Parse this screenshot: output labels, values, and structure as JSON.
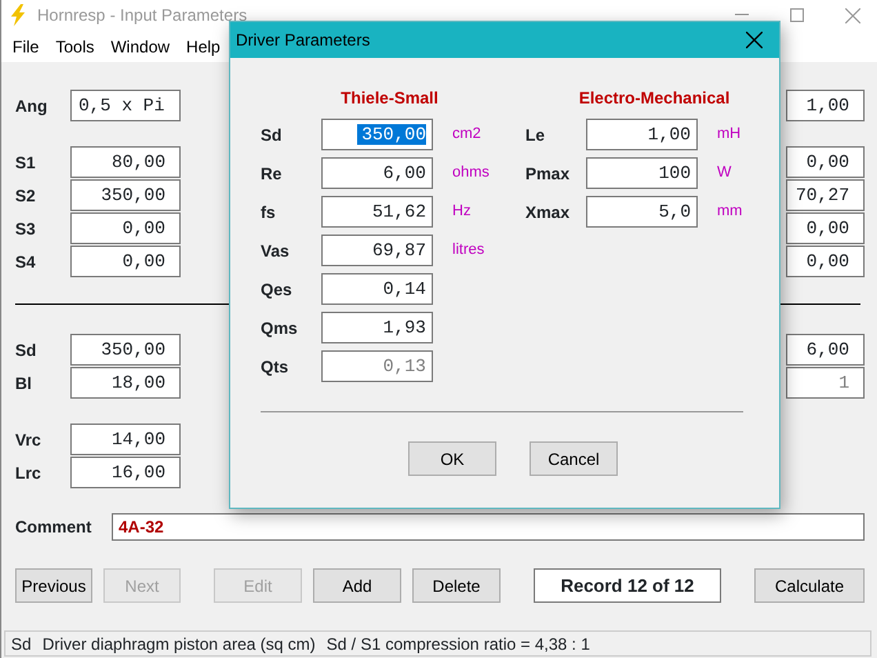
{
  "window": {
    "title": "Hornresp - Input Parameters"
  },
  "menu": [
    "File",
    "Tools",
    "Window",
    "Help"
  ],
  "upper": {
    "left": [
      [
        {
          "kind": "text",
          "label": "Ang",
          "value": "0,5 x Pi"
        }
      ],
      [
        {
          "kind": "number",
          "label": "S1",
          "value": "80,00"
        },
        {
          "kind": "number",
          "label": "S2",
          "value": "350,00"
        },
        {
          "kind": "number",
          "label": "S3",
          "value": "0,00"
        },
        {
          "kind": "number",
          "label": "S4",
          "value": "0,00"
        }
      ]
    ],
    "right": [
      [
        {
          "value": "1,00",
          "disabled": false
        }
      ],
      [
        {
          "value": "0,00",
          "disabled": false
        },
        {
          "value": "70,27",
          "disabled": false
        },
        {
          "value": "0,00",
          "disabled": false
        },
        {
          "value": "0,00",
          "disabled": false
        }
      ]
    ]
  },
  "lower": {
    "left": [
      [
        {
          "kind": "number",
          "label": "Sd",
          "value": "350,00"
        },
        {
          "kind": "number",
          "label": "Bl",
          "value": "18,00"
        }
      ],
      [
        {
          "kind": "number",
          "label": "Vrc",
          "value": "14,00"
        },
        {
          "kind": "number",
          "label": "Lrc",
          "value": "16,00"
        }
      ]
    ],
    "right": [
      [
        {
          "value": "6,00",
          "disabled": false
        },
        {
          "value": "1",
          "disabled": true
        }
      ]
    ]
  },
  "comment": {
    "label": "Comment",
    "value": "4A-32"
  },
  "buttons": [
    {
      "kind": "button",
      "label": "Previous",
      "disabled": false
    },
    {
      "kind": "button",
      "label": "Next",
      "disabled": true
    },
    {
      "kind": "button",
      "label": "Edit",
      "disabled": true
    },
    {
      "kind": "button",
      "label": "Add",
      "disabled": false
    },
    {
      "kind": "button",
      "label": "Delete",
      "disabled": false
    },
    {
      "kind": "record",
      "label": "Record 12 of 12"
    },
    {
      "kind": "button",
      "label": "Calculate",
      "disabled": false
    }
  ],
  "status_bar": [
    "Sd",
    "Driver diaphragm piston area  (sq cm)",
    "Sd / S1 compression ratio = 4,38 : 1"
  ],
  "dialog": {
    "title": "Driver Parameters",
    "sections": [
      {
        "heading": "Thiele-Small",
        "rows": [
          {
            "label": "Sd",
            "value": "350,00",
            "unit": "cm2",
            "selected": true,
            "disabled": false
          },
          {
            "label": "Re",
            "value": "6,00",
            "unit": "ohms",
            "selected": false,
            "disabled": false
          },
          {
            "label": "fs",
            "value": "51,62",
            "unit": "Hz",
            "selected": false,
            "disabled": false
          },
          {
            "label": "Vas",
            "value": "69,87",
            "unit": "litres",
            "selected": false,
            "disabled": false
          },
          {
            "label": "Qes",
            "value": "0,14",
            "selected": false,
            "disabled": false
          },
          {
            "label": "Qms",
            "value": "1,93",
            "selected": false,
            "disabled": false
          },
          {
            "label": "Qts",
            "value": "0,13",
            "selected": false,
            "disabled": true
          }
        ]
      },
      {
        "heading": "Electro-Mechanical",
        "rows": [
          {
            "label": "Le",
            "value": "1,00",
            "unit": "mH",
            "selected": false,
            "disabled": false
          },
          {
            "label": "Pmax",
            "value": "100",
            "unit": "W",
            "selected": false,
            "disabled": false
          },
          {
            "label": "Xmax",
            "value": "5,0",
            "unit": "mm",
            "selected": false,
            "disabled": false
          }
        ]
      }
    ],
    "buttons": [
      "OK",
      "Cancel"
    ]
  }
}
